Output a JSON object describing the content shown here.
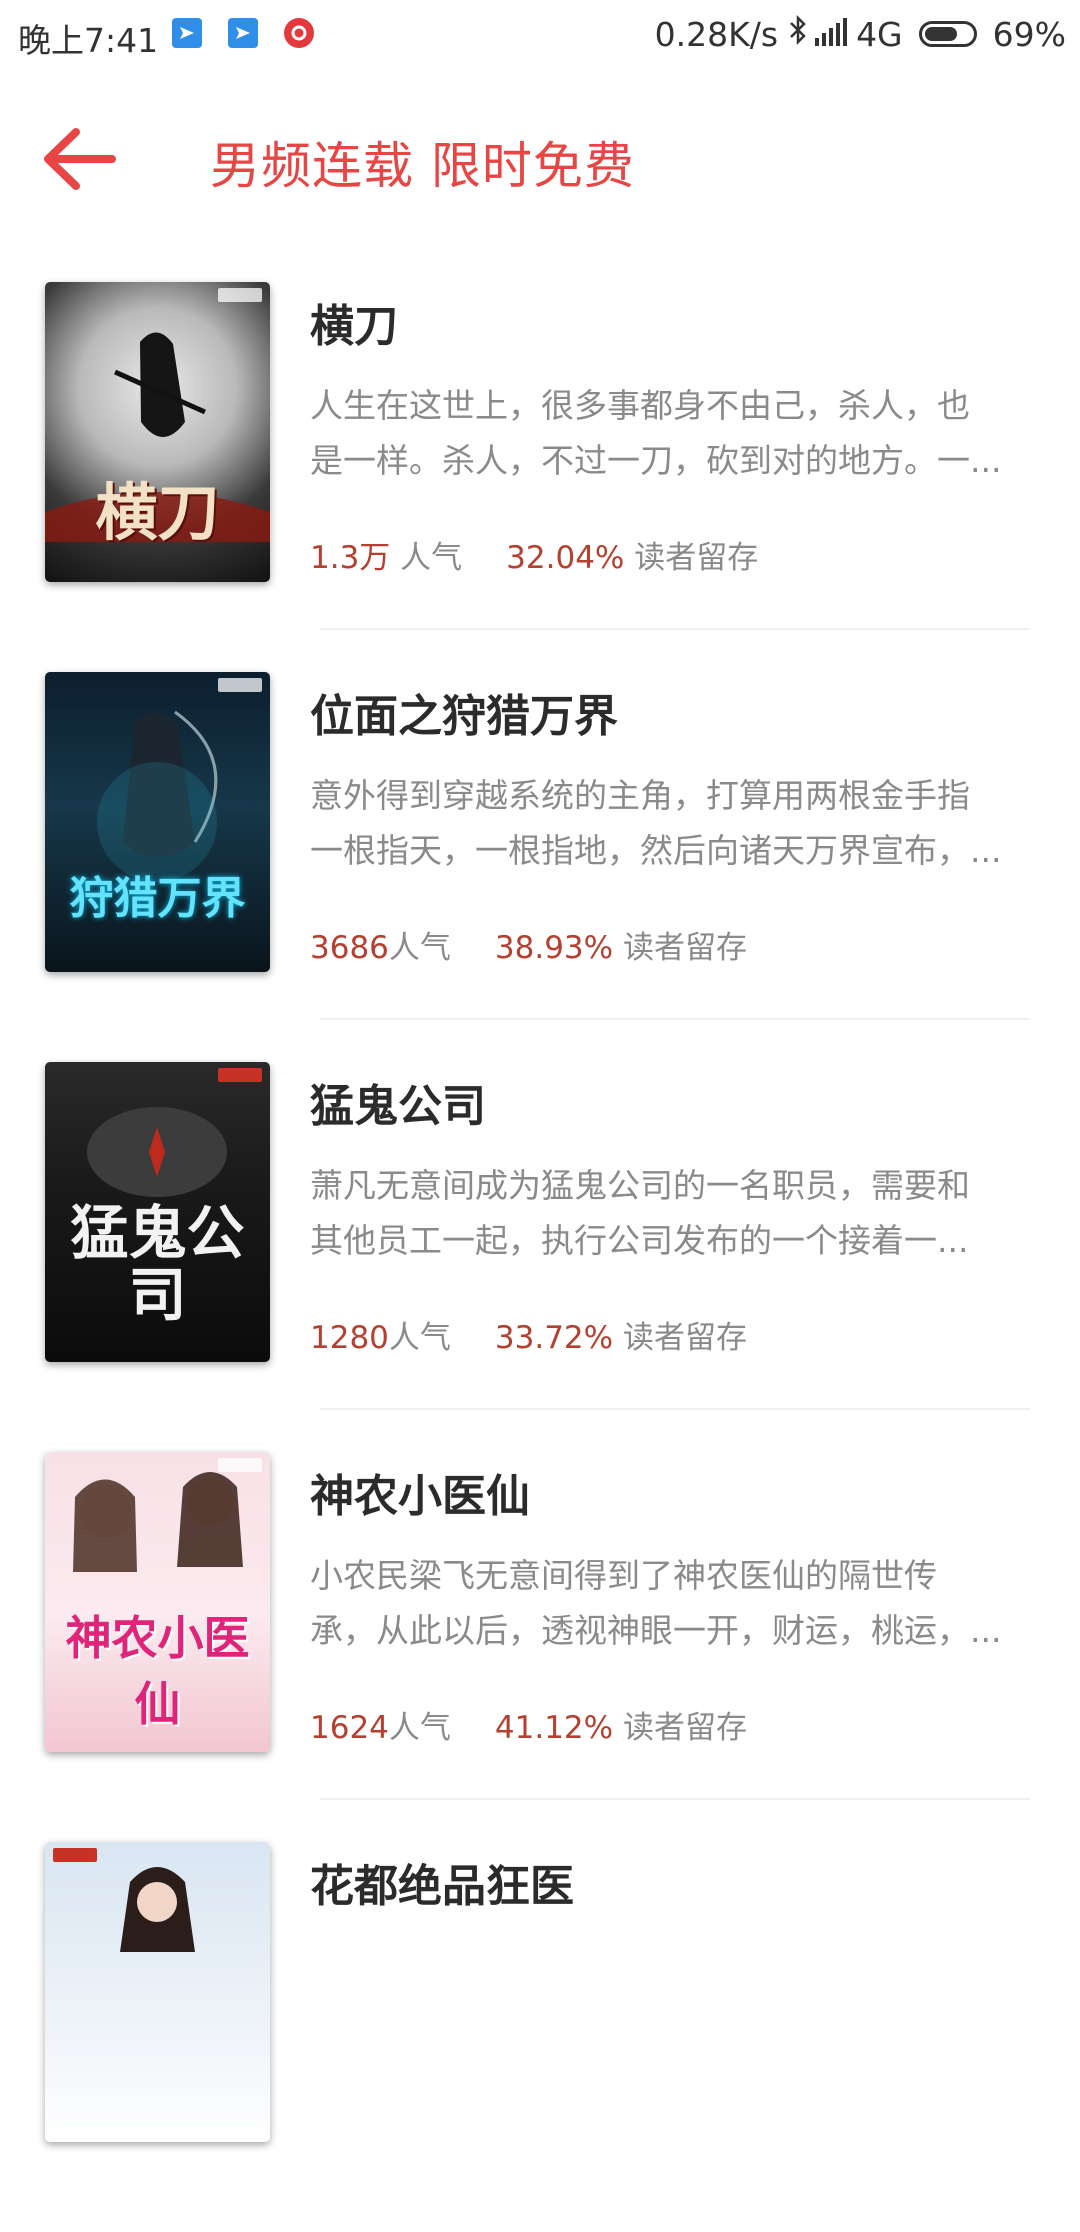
{
  "status_bar": {
    "time": "晚上7:41",
    "net_speed": "0.28K/s",
    "network": "4G",
    "battery": "69%",
    "battery_level": 0.69
  },
  "header": {
    "title": "男频连载 限时免费",
    "accent_color": "#e84545"
  },
  "books": [
    {
      "title": "横刀",
      "desc_line1": "人生在这世上，很多事都身不由己，杀人，也",
      "desc_line2": "是一样。杀人，不过一刀，砍到对的地方。一...",
      "popularity_value": "1.3万",
      "popularity_label": " 人气",
      "retention_value": "32.04%",
      "retention_label": " 读者留存",
      "cover_text": "横刀"
    },
    {
      "title": "位面之狩猎万界",
      "desc_line1": "意外得到穿越系统的主角，打算用两根金手指",
      "desc_line2": "一根指天，一根指地，然后向诸天万界宣布，...",
      "popularity_value": "3686",
      "popularity_label": "人气",
      "retention_value": "38.93%",
      "retention_label": " 读者留存",
      "cover_text": "狩猎万界"
    },
    {
      "title": "猛鬼公司",
      "desc_line1": "萧凡无意间成为猛鬼公司的一名职员，需要和",
      "desc_line2": "其他员工一起，执行公司发布的一个接着一...",
      "popularity_value": "1280",
      "popularity_label": "人气",
      "retention_value": "33.72%",
      "retention_label": " 读者留存",
      "cover_text": "猛鬼公司"
    },
    {
      "title": "神农小医仙",
      "desc_line1": "小农民梁飞无意间得到了神农医仙的隔世传",
      "desc_line2": "承，从此以后，透视神眼一开，财运，桃运，...",
      "popularity_value": "1624",
      "popularity_label": "人气",
      "retention_value": "41.12%",
      "retention_label": " 读者留存",
      "cover_text": "神农小医仙"
    },
    {
      "title": "花都绝品狂医"
    }
  ]
}
